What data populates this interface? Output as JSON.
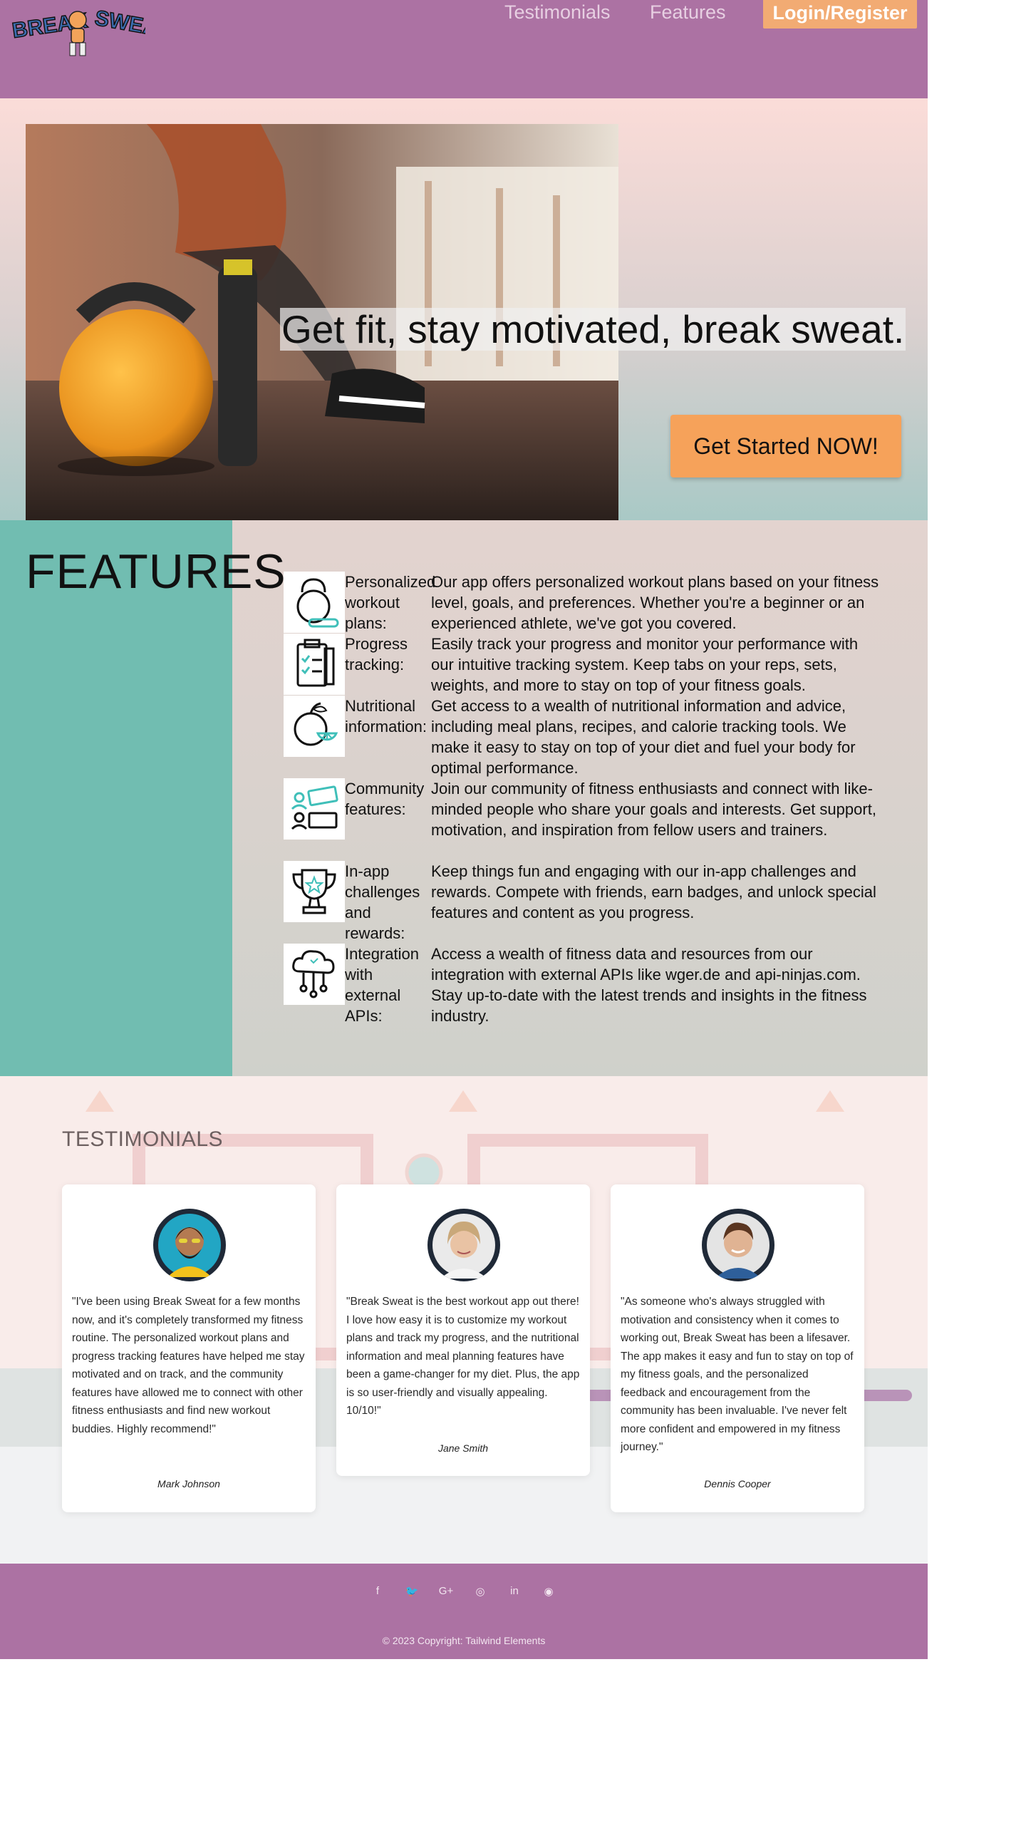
{
  "nav": {
    "logo_text": "BREAK SWEAT",
    "links": [
      "Testimonials",
      "Features"
    ],
    "login": "Login/Register"
  },
  "hero": {
    "title": "Get fit, stay motivated, break sweat.",
    "cta": "Get Started NOW!"
  },
  "features": {
    "heading": "FEATURES",
    "items": [
      {
        "icon": "kettlebell-icon",
        "name": "Personalized workout plans:",
        "desc": "Our app offers personalized workout plans based on your fitness level, goals, and preferences. Whether you're a beginner or an experienced athlete, we've got you covered."
      },
      {
        "icon": "clipboard-icon",
        "name": "Progress tracking:",
        "desc": "Easily track your progress and monitor your performance with our intuitive tracking system. Keep tabs on your reps, sets, weights, and more to stay on top of your fitness goals."
      },
      {
        "icon": "apple-icon",
        "name": "Nutritional information:",
        "desc": "Get access to a wealth of nutritional information and advice, including meal plans, recipes, and calorie tracking tools. We make it easy to stay on top of your diet and fuel your body for optimal performance."
      },
      {
        "icon": "community-chat-icon",
        "name": "Community features:",
        "desc": "Join our community of fitness enthusiasts and connect with like-minded people who share your goals and interests. Get support, motivation, and inspiration from fellow users and trainers."
      },
      {
        "icon": "trophy-icon",
        "name": "In-app challenges and rewards:",
        "desc": "Keep things fun and engaging with our in-app challenges and rewards. Compete with friends, earn badges, and unlock special features and content as you progress."
      },
      {
        "icon": "cloud-network-icon",
        "name": "Integration with external APIs:",
        "desc": "Access a wealth of fitness data and resources from our integration with external APIs like wger.de and api-ninjas.com. Stay up-to-date with the latest trends and insights in the fitness industry."
      }
    ]
  },
  "testimonials": {
    "heading": "TESTIMONIALS",
    "cards": [
      {
        "quote": "\"I've been using Break Sweat for a few months now, and it's completely transformed my fitness routine. The personalized workout plans and progress tracking features have helped me stay motivated and on track, and the community features have allowed me to connect with other fitness enthusiasts and find new workout buddies. Highly recommend!\"",
        "author": "Mark Johnson"
      },
      {
        "quote": "\"Break Sweat is the best workout app out there! I love how easy it is to customize my workout plans and track my progress, and the nutritional information and meal planning features have been a game-changer for my diet. Plus, the app is so user-friendly and visually appealing. 10/10!\"",
        "author": "Jane Smith"
      },
      {
        "quote": "\"As someone who's always struggled with motivation and consistency when it comes to working out, Break Sweat has been a lifesaver. The app makes it easy and fun to stay on top of my fitness goals, and the personalized feedback and encouragement from the community has been invaluable. I've never felt more confident and empowered in my fitness journey.\"",
        "author": "Dennis Cooper"
      }
    ]
  },
  "footer": {
    "social": [
      {
        "icon": "facebook-icon",
        "glyph": "f"
      },
      {
        "icon": "twitter-icon",
        "glyph": "🐦"
      },
      {
        "icon": "google-plus-icon",
        "glyph": "G+"
      },
      {
        "icon": "instagram-icon",
        "glyph": "◎"
      },
      {
        "icon": "linkedin-icon",
        "glyph": "in"
      },
      {
        "icon": "github-icon",
        "glyph": "◉"
      }
    ],
    "copyright": "© 2023 Copyright: Tailwind Elements"
  },
  "colors": {
    "nav_bg": "#ac72a3",
    "accent_orange": "#f6a25a",
    "teal": "#71bdb1",
    "icon_teal": "#3fbfb9"
  }
}
